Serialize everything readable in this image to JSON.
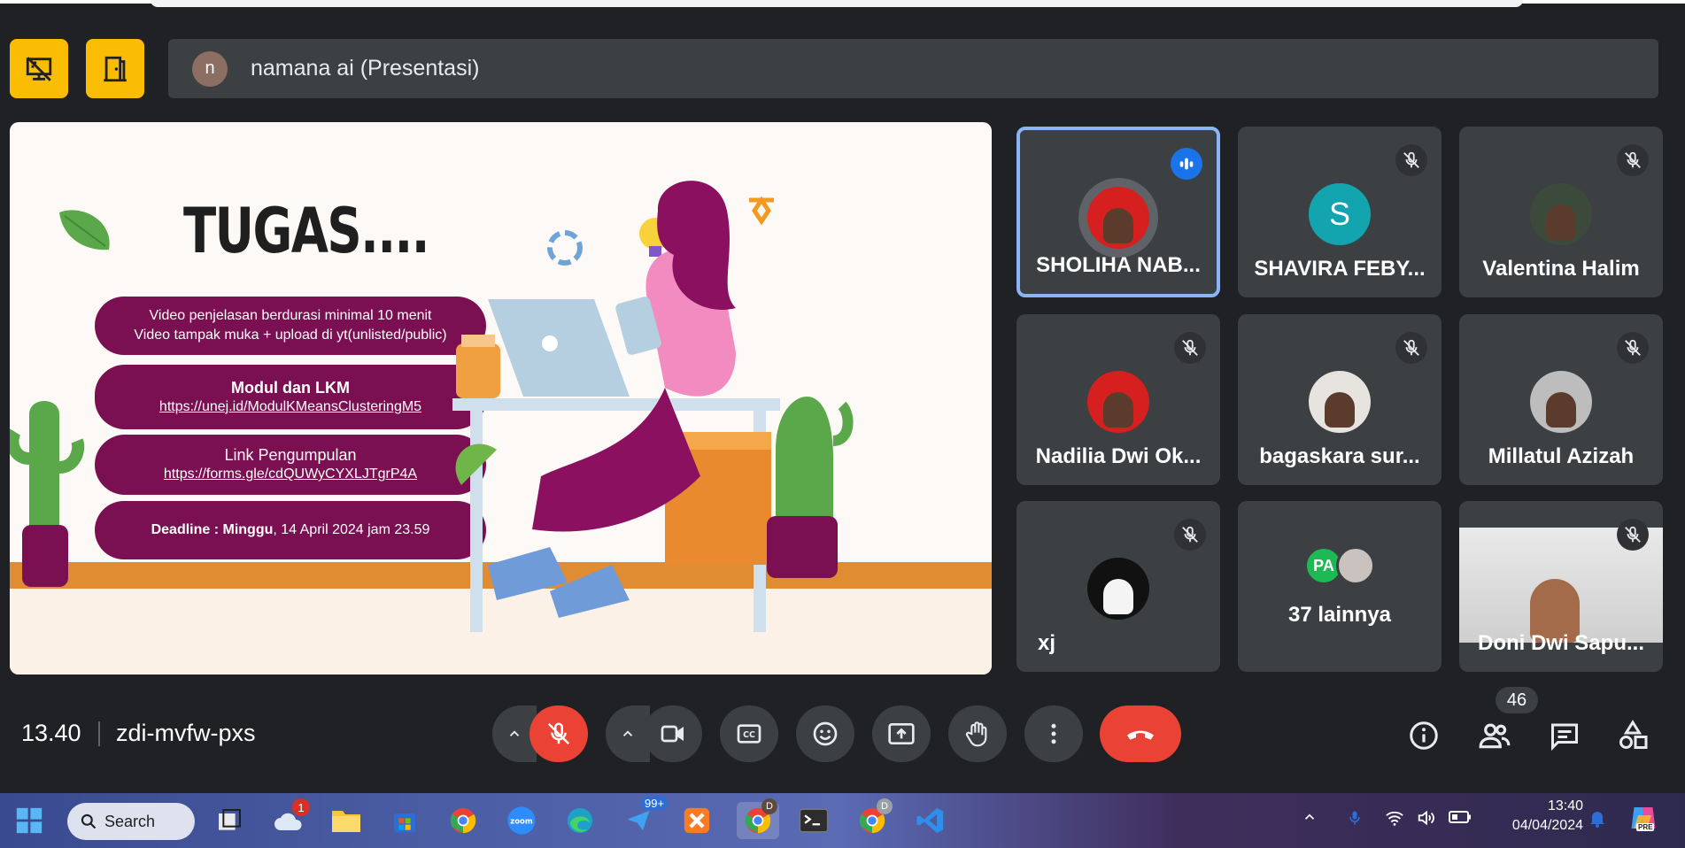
{
  "meeting": {
    "presenter_initial": "n",
    "presenter_label": "namana ai (Presentasi)",
    "time": "13.40",
    "code": "zdi-mvfw-pxs",
    "participant_count": "46"
  },
  "slide": {
    "title": "TUGAS....",
    "card1_line1": "Video penjelasan berdurasi minimal 10 menit",
    "card1_line2": "Video tampak muka + upload di yt(unlisted/public)",
    "card2_title": "Modul dan LKM",
    "card2_link": "https://unej.id/ModulKMeansClusteringM5",
    "card3_title": "Link Pengumpulan",
    "card3_link": "https://forms.gle/cdQUWyCYXLJTgrP4A",
    "card4_bold": "Deadline : Minggu",
    "card4_rest": ", 14 April 2024 jam 23.59"
  },
  "participants": [
    {
      "name": "SHOLIHA NAB...",
      "initial": "",
      "color": "#d61f1f"
    },
    {
      "name": "SHAVIRA FEBY...",
      "initial": "S",
      "color": "#12a4af"
    },
    {
      "name": "Valentina Halim",
      "initial": "",
      "color": "#3b4a3a"
    },
    {
      "name": "Nadilia Dwi Ok...",
      "initial": "",
      "color": "#d61f1f"
    },
    {
      "name": "bagaskara sur...",
      "initial": "",
      "color": "#e7e3df"
    },
    {
      "name": "Millatul Azizah",
      "initial": "",
      "color": "#bdbdbd"
    },
    {
      "name": "xj",
      "initial": "",
      "color": "#111111"
    },
    {
      "name": "37 lainnya",
      "initial": "",
      "color": "#1db954"
    },
    {
      "name": "Doni Dwi Sapu...",
      "initial": "",
      "color": "#f2f2f2"
    }
  ],
  "others_avatar_initial": "PA",
  "taskbar": {
    "search_label": "Search",
    "weather_badge": "1",
    "outlook_badge": "99+",
    "chrome_badge": "D",
    "chrome2_badge": "D",
    "tray_time": "13:40",
    "tray_date": "04/04/2024",
    "copilot_badge": "PRE"
  },
  "colors": {
    "accent_yellow": "#fbbc04",
    "end_call_red": "#ea4335",
    "slide_purple": "#7a0f52",
    "active_speaker_border": "#8ab4f8"
  }
}
